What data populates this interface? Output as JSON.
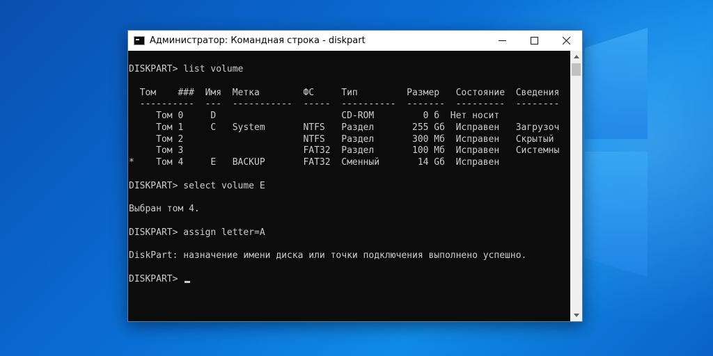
{
  "window": {
    "title": "Администратор: Командная строка - diskpart",
    "minimize_icon": "minimize-icon",
    "maximize_icon": "maximize-icon",
    "close_icon": "close-icon"
  },
  "console": {
    "lines": [
      "DISKPART> list volume",
      "",
      "  Том    ###  Имя  Метка        ФС     Тип         Размер   Состояние  Сведения",
      "  ----------  ---  -----------  -----  ----------  -------  ---------  --------",
      "     Том 0     D                       CD-ROM         0 б  Нет носит",
      "     Том 1     C   System       NTFS   Раздел       255 Gб  Исправен   Загрузоч",
      "     Том 2                      NTFS   Раздел       300 Мб  Исправен   Скрытый",
      "     Том 3                      FAT32  Раздел       100 Мб  Исправен   Системны",
      "*    Том 4     E   BACKUP       FAT32  Сменный       14 Gб  Исправен",
      "",
      "DISKPART> select volume E",
      "",
      "Выбран том 4.",
      "",
      "DISKPART> assign letter=A",
      "",
      "DiskPart: назначение имени диска или точки подключения выполнено успешно.",
      "",
      "DISKPART> "
    ]
  },
  "colors": {
    "console_bg": "#0c0c0c",
    "console_text": "#cccccc",
    "desktop_accent": "#0a6fd6"
  }
}
